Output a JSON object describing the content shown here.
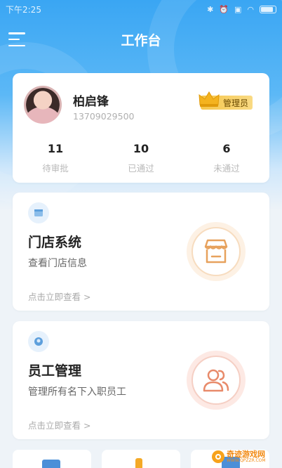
{
  "status_bar": {
    "time": "下午2:25"
  },
  "header": {
    "title": "工作台"
  },
  "profile": {
    "name": "柏启锋",
    "phone": "13709029500",
    "role_badge": "管理员",
    "stats": [
      {
        "value": "11",
        "label": "待审批"
      },
      {
        "value": "10",
        "label": "已通过"
      },
      {
        "value": "6",
        "label": "未通过"
      }
    ]
  },
  "modules": [
    {
      "title": "门店系统",
      "subtitle": "查看门店信息",
      "link": "点击立即查看 >",
      "icon": "store-icon"
    },
    {
      "title": "员工管理",
      "subtitle": "管理所有名下入职员工",
      "link": "点击立即查看 >",
      "icon": "staff-icon"
    }
  ],
  "watermark": {
    "text": "奇迹游戏网",
    "url": "WWW.QPZZR.COM"
  },
  "colors": {
    "accent": "#3aa6f3",
    "store_accent": "#e7a25d",
    "staff_accent": "#e88a6a",
    "badge": "#f6c64b"
  }
}
